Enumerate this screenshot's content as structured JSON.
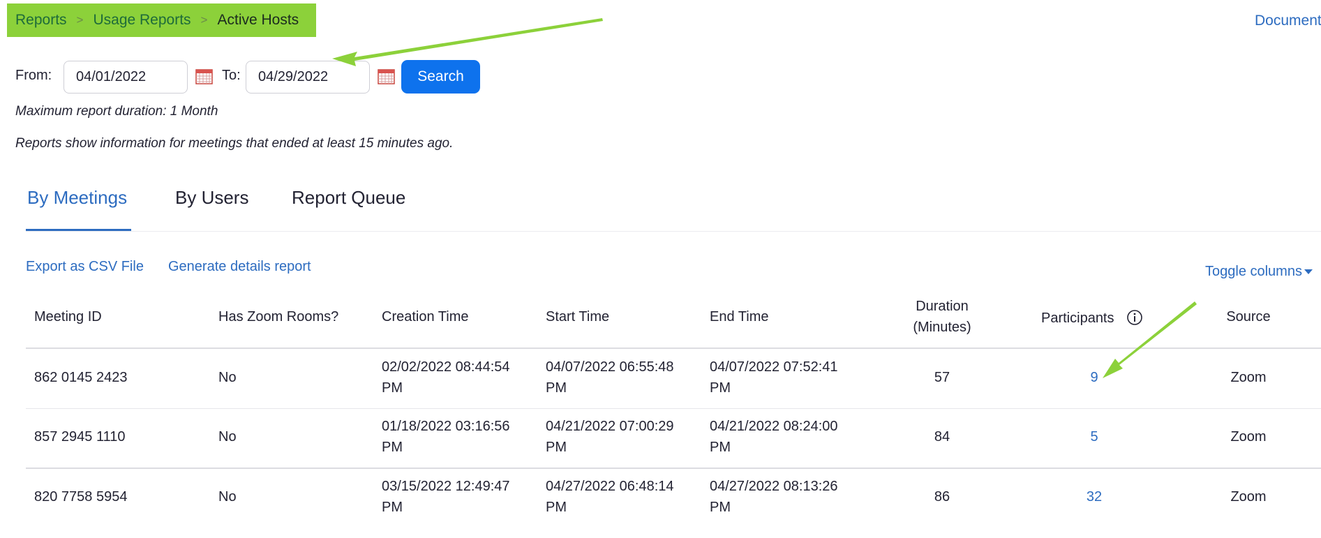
{
  "breadcrumb": {
    "items": [
      "Reports",
      "Usage Reports",
      "Active Hosts"
    ],
    "separator": ">"
  },
  "header": {
    "doc_link": "Document"
  },
  "filters": {
    "from_label": "From:",
    "from_value": "04/01/2022",
    "to_label": "To:",
    "to_value": "04/29/2022",
    "search_label": "Search"
  },
  "notes": {
    "max_duration": "Maximum report duration: 1 Month",
    "info": "Reports show information for meetings that ended at least 15 minutes ago."
  },
  "tabs": [
    {
      "label": "By Meetings",
      "active": true
    },
    {
      "label": "By Users",
      "active": false
    },
    {
      "label": "Report Queue",
      "active": false
    }
  ],
  "actions": {
    "export_csv": "Export as CSV File",
    "generate_details": "Generate details report",
    "toggle_columns": "Toggle columns"
  },
  "table": {
    "columns": [
      {
        "key": "meeting_id",
        "label": "Meeting ID"
      },
      {
        "key": "has_zoom_rooms",
        "label": "Has Zoom Rooms?"
      },
      {
        "key": "creation_time",
        "label": "Creation Time"
      },
      {
        "key": "start_time",
        "label": "Start Time"
      },
      {
        "key": "end_time",
        "label": "End Time"
      },
      {
        "key": "duration",
        "label_line1": "Duration",
        "label_line2": "(Minutes)"
      },
      {
        "key": "participants",
        "label": "Participants"
      },
      {
        "key": "source",
        "label": "Source"
      }
    ],
    "rows": [
      {
        "meeting_id": "862 0145 2423",
        "has_zoom_rooms": "No",
        "creation_time": [
          "02/02/2022 08:44:54",
          "PM"
        ],
        "start_time": [
          "04/07/2022 06:55:48",
          "PM"
        ],
        "end_time": [
          "04/07/2022 07:52:41",
          "PM"
        ],
        "duration": "57",
        "participants": "9",
        "source": "Zoom"
      },
      {
        "meeting_id": "857 2945 1110",
        "has_zoom_rooms": "No",
        "creation_time": [
          "01/18/2022 03:16:56",
          "PM"
        ],
        "start_time": [
          "04/21/2022 07:00:29",
          "PM"
        ],
        "end_time": [
          "04/21/2022 08:24:00",
          "PM"
        ],
        "duration": "84",
        "participants": "5",
        "source": "Zoom"
      },
      {
        "meeting_id": "820 7758 5954",
        "has_zoom_rooms": "No",
        "creation_time": [
          "03/15/2022 12:49:47",
          "PM"
        ],
        "start_time": [
          "04/27/2022 06:48:14",
          "PM"
        ],
        "end_time": [
          "04/27/2022 08:13:26",
          "PM"
        ],
        "duration": "86",
        "participants": "32",
        "source": "Zoom"
      }
    ]
  },
  "icons": {
    "calendar": "calendar-icon",
    "info": "info-icon",
    "caret": "caret-down-icon"
  },
  "colors": {
    "accent": "#2d6cc0",
    "button": "#0e72ed",
    "highlight": "#8cd13a",
    "annotation_arrow": "#8cd13a"
  }
}
